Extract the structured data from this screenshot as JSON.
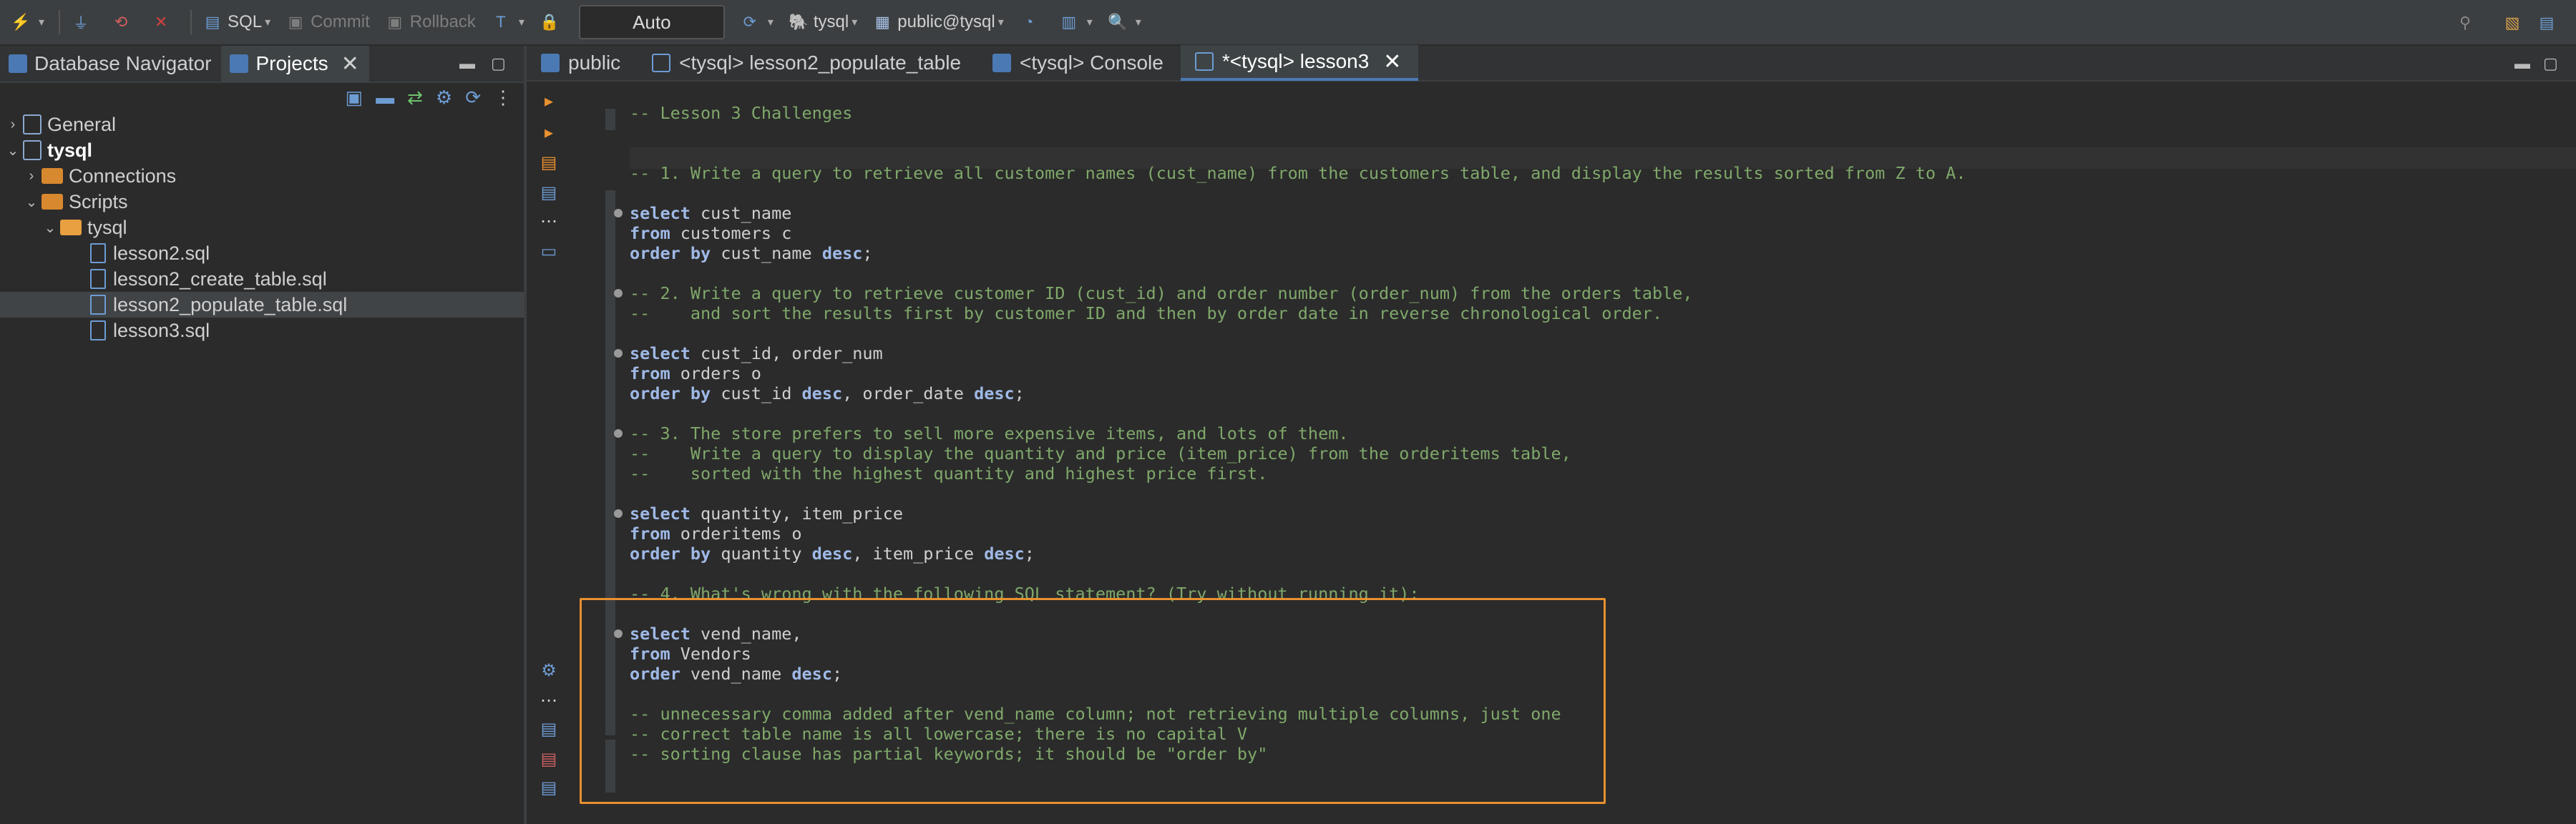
{
  "toolbar": {
    "sql_label": "SQL",
    "commit_label": "Commit",
    "rollback_label": "Rollback",
    "mode_value": "Auto",
    "datasource": "tysql",
    "schema": "public@tysql"
  },
  "left_panel": {
    "tabs": [
      {
        "label": "Database Navigator"
      },
      {
        "label": "Projects"
      }
    ],
    "tree": {
      "general": "General",
      "project": "tysql",
      "connections": "Connections",
      "scripts": "Scripts",
      "script_folder": "tysql",
      "files": [
        "lesson2.sql",
        "lesson2_create_table.sql",
        "lesson2_populate_table.sql",
        "lesson3.sql"
      ],
      "selected_file": "lesson2_populate_table.sql"
    }
  },
  "editor": {
    "tabs": [
      {
        "label": "public",
        "active": false
      },
      {
        "label": "<tysql> lesson2_populate_table",
        "active": false
      },
      {
        "label": "<tysql> Console",
        "active": false
      },
      {
        "label": "*<tysql> lesson3",
        "active": true
      }
    ],
    "lines": {
      "l1": "-- Lesson 3 Challenges",
      "l2": "",
      "l3": "",
      "l4": "-- 1. Write a query to retrieve all customer names (cust_name) from the customers table, and display the results sorted from Z to A.",
      "l5": "",
      "l6a": "select",
      "l6b": " cust_name",
      "l7a": "from",
      "l7b": " customers c",
      "l8a": "order by",
      "l8b": " cust_name ",
      "l8c": "desc",
      "l8d": ";",
      "l9": "",
      "l10": "-- 2. Write a query to retrieve customer ID (cust_id) and order number (order_num) from the orders table,",
      "l11": "--    and sort the results first by customer ID and then by order date in reverse chronological order.",
      "l12": "",
      "l13a": "select",
      "l13b": " cust_id, order_num",
      "l14a": "from",
      "l14b": " orders o",
      "l15a": "order by",
      "l15b": " cust_id ",
      "l15c": "desc",
      "l15d": ", order_date ",
      "l15e": "desc",
      "l15f": ";",
      "l16": "",
      "l17": "-- 3. The store prefers to sell more expensive items, and lots of them.",
      "l18": "--    Write a query to display the quantity and price (item_price) from the orderitems table,",
      "l19": "--    sorted with the highest quantity and highest price first.",
      "l20": "",
      "l21a": "select",
      "l21b": " quantity, item_price",
      "l22a": "from",
      "l22b": " orderitems o",
      "l23a": "order by",
      "l23b": " quantity ",
      "l23c": "desc",
      "l23d": ", item_price ",
      "l23e": "desc",
      "l23f": ";",
      "l24": "",
      "l25": "-- 4. What's wrong with the following SQL statement? (Try without running it):",
      "l26": "",
      "l27a": "select",
      "l27b": " vend_name,",
      "l28a": "from",
      "l28b": " Vendors",
      "l29a": "order",
      "l29b": " vend_name ",
      "l29c": "desc",
      "l29d": ";",
      "l30": "",
      "l31": "-- unnecessary comma added after vend_name column; not retrieving multiple columns, just one",
      "l32": "-- correct table name is all lowercase; there is no capital V",
      "l33": "-- sorting clause has partial keywords; it should be \"order by\""
    }
  },
  "colors": {
    "background": "#2b2b2b",
    "comment": "#7fa86a",
    "keyword": "#9fb9e6",
    "highlight_border": "#e8902f",
    "accent": "#4b79b3"
  }
}
